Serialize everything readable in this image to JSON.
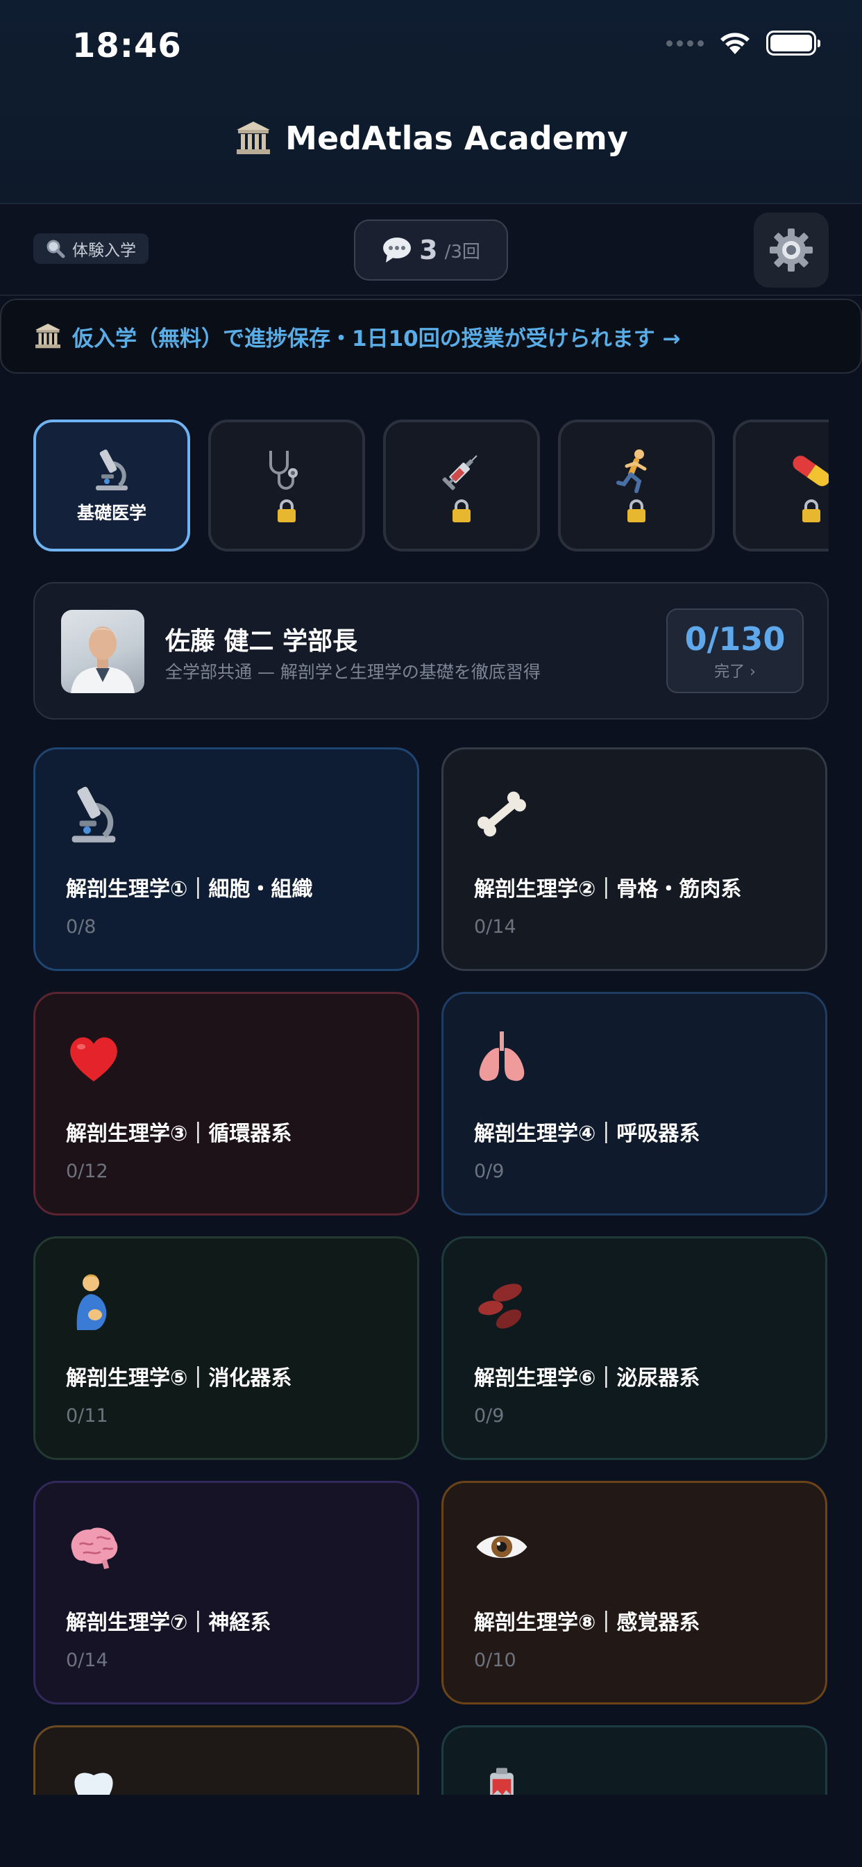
{
  "status_bar": {
    "time": "18:46"
  },
  "header": {
    "title": "MedAtlas Academy",
    "title_icon": "classical-building-icon"
  },
  "toolbar": {
    "trial_label": "体験入学",
    "counter_current": "3",
    "counter_total": "/3回"
  },
  "banner": {
    "text": "仮入学（無料）で進捗保存・1日10回の授業が受けられます →"
  },
  "tabs": [
    {
      "label": "基礎医学",
      "icon": "microscope-icon",
      "active": true,
      "locked": false
    },
    {
      "label": "",
      "icon": "stethoscope-icon",
      "active": false,
      "locked": true
    },
    {
      "label": "",
      "icon": "syringe-icon",
      "active": false,
      "locked": true
    },
    {
      "label": "",
      "icon": "runner-icon",
      "active": false,
      "locked": true
    },
    {
      "label": "",
      "icon": "pill-icon",
      "active": false,
      "locked": true
    }
  ],
  "instructor": {
    "name": "佐藤 健二 学部長",
    "description": "全学部共通 — 解剖学と生理学の基礎を徹底習得",
    "progress": "0/130",
    "progress_label": "完了 ›"
  },
  "courses": [
    {
      "title": "解剖生理学①｜細胞・組織",
      "progress": "0/8",
      "icon": "microscope-icon"
    },
    {
      "title": "解剖生理学②｜骨格・筋肉系",
      "progress": "0/14",
      "icon": "bone-icon"
    },
    {
      "title": "解剖生理学③｜循環器系",
      "progress": "0/12",
      "icon": "heart-icon"
    },
    {
      "title": "解剖生理学④｜呼吸器系",
      "progress": "0/9",
      "icon": "lungs-icon"
    },
    {
      "title": "解剖生理学⑤｜消化器系",
      "progress": "0/11",
      "icon": "person-icon"
    },
    {
      "title": "解剖生理学⑥｜泌尿器系",
      "progress": "0/9",
      "icon": "beans-icon"
    },
    {
      "title": "解剖生理学⑦｜神経系",
      "progress": "0/14",
      "icon": "brain-icon"
    },
    {
      "title": "解剖生理学⑧｜感覚器系",
      "progress": "0/10",
      "icon": "eye-icon"
    },
    {
      "title": "",
      "progress": "",
      "icon": "tooth-icon"
    },
    {
      "title": "",
      "progress": "",
      "icon": "battery-icon"
    }
  ],
  "colors": {
    "accent": "#5fa8ec",
    "banner_text": "#5aaee8",
    "active_tab_border": "#6fb3f2",
    "background": "#0b111e"
  }
}
